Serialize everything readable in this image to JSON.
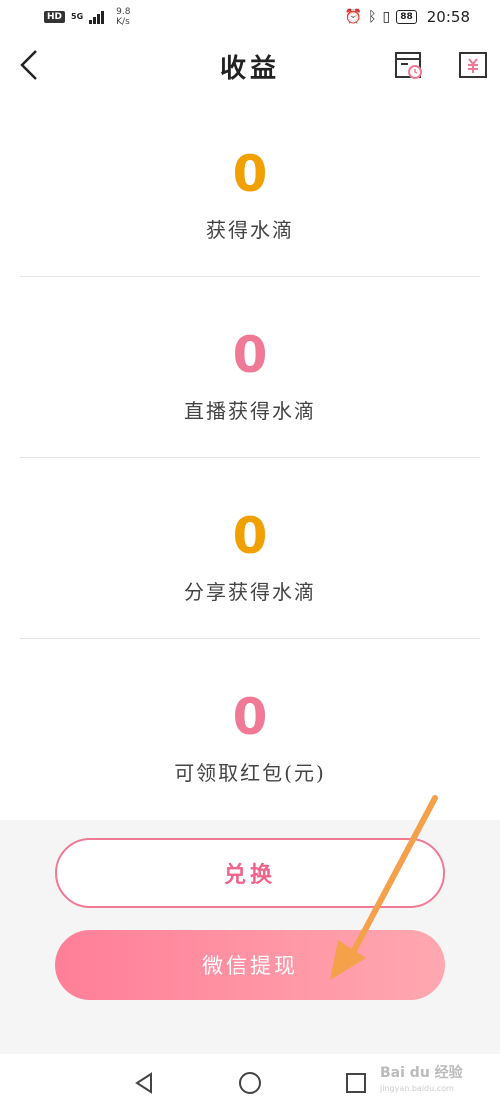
{
  "status_bar": {
    "hd": "HD",
    "network": "5G",
    "speed_value": "9.8",
    "speed_unit": "K/s",
    "battery": "88",
    "time": "20:58"
  },
  "header": {
    "title": "收益",
    "back_icon": "chevron-left-icon",
    "right_icons": [
      "calendar-clock-icon",
      "yuan-bill-icon"
    ]
  },
  "stats": [
    {
      "value": "0",
      "label": "获得水滴",
      "color": "#f0a000"
    },
    {
      "value": "0",
      "label": "直播获得水滴",
      "color": "#f07a95"
    },
    {
      "value": "0",
      "label": "分享获得水滴",
      "color": "#f0a000"
    },
    {
      "value": "0",
      "label": "可领取红包(元)",
      "color": "#f07a95"
    }
  ],
  "actions": {
    "exchange_label": "兑换",
    "wechat_withdraw_label": "微信提现"
  },
  "watermark": {
    "text": "Bai du 经验",
    "sub": "jingyan.baidu.com"
  },
  "colors": {
    "accent_orange": "#f0a000",
    "accent_pink": "#f07a95",
    "annotation_arrow": "#f5a04a"
  }
}
